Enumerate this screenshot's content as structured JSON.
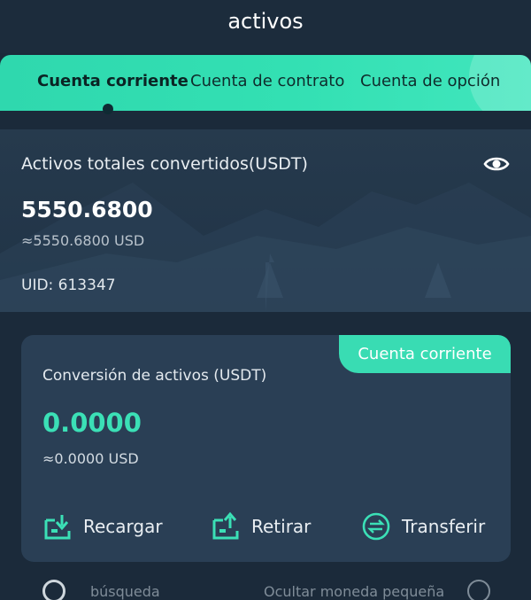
{
  "header": {
    "title": "activos"
  },
  "tabs": [
    {
      "label": "Cuenta corriente",
      "active": true
    },
    {
      "label": "Cuenta de contrato",
      "active": false
    },
    {
      "label": "Cuenta de opción",
      "active": false
    }
  ],
  "summary": {
    "label": "Activos totales convertidos(USDT)",
    "value": "5550.6800",
    "usd": "≈5550.6800 USD",
    "uid": "UID: 613347",
    "icon": "eye-icon"
  },
  "card": {
    "badge": "Cuenta corriente",
    "title": "Conversión de activos (USDT)",
    "value": "0.0000",
    "usd": "≈0.0000 USD",
    "actions": [
      {
        "label": "Recargar",
        "icon": "deposit-icon"
      },
      {
        "label": "Retirar",
        "icon": "withdraw-icon"
      },
      {
        "label": "Transferir",
        "icon": "transfer-icon"
      }
    ]
  },
  "filters": {
    "search_placeholder": "búsqueda",
    "hide_small_label": "Ocultar moneda pequeña"
  },
  "colors": {
    "background": "#1b2a3a",
    "accent": "#39dcb3",
    "card": "#2a3f55"
  }
}
